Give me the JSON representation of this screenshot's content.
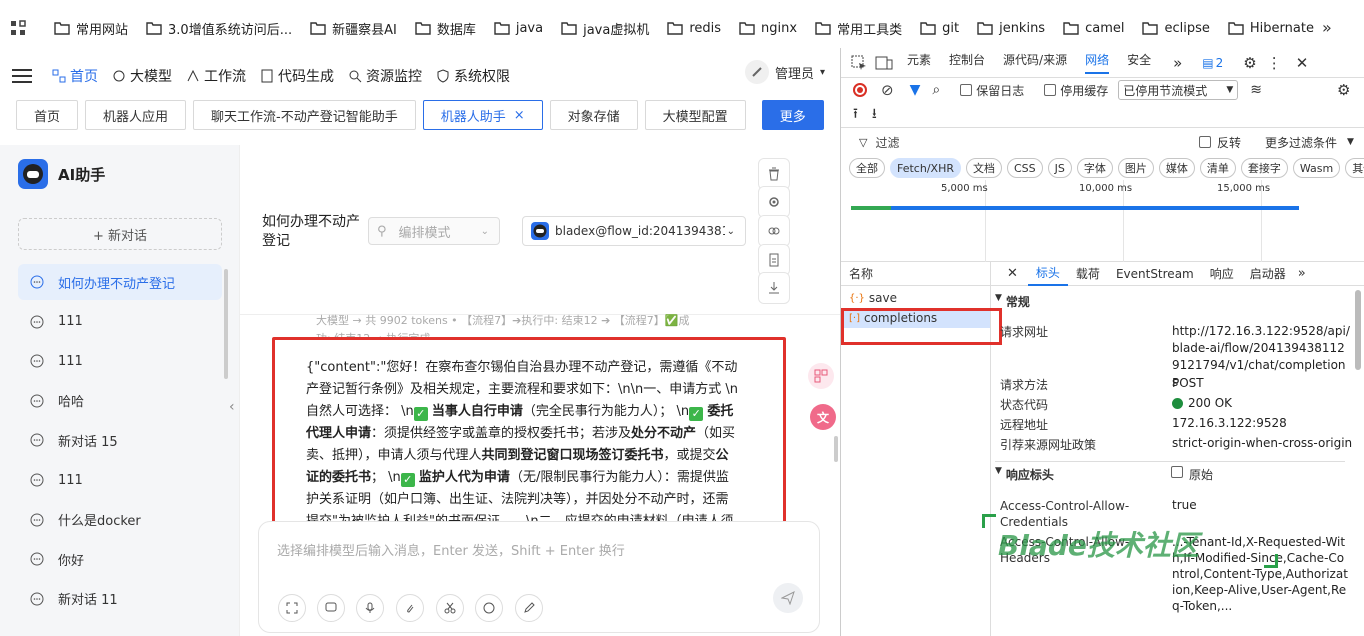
{
  "bookmarks": [
    "常用网站",
    "3.0增值系统访问后...",
    "新疆察县AI",
    "数据库",
    "java",
    "java虚拟机",
    "redis",
    "nginx",
    "常用工具类",
    "git",
    "jenkins",
    "camel",
    "eclipse",
    "Hibernate"
  ],
  "nav": {
    "items": [
      "首页",
      "大模型",
      "工作流",
      "代码生成",
      "资源监控",
      "系统权限"
    ],
    "user": "管理员"
  },
  "tabs": [
    "首页",
    "机器人应用",
    "聊天工作流-不动产登记智能助手",
    "机器人助手",
    "对象存储",
    "大模型配置"
  ],
  "tabs_more": "更多",
  "tab_close": "×",
  "sidebar": {
    "title": "AI助手",
    "new_chat": "+ 新对话",
    "chats": [
      "如何办理不动产登记",
      "111",
      "111",
      "哈哈",
      "新对话 15",
      "111",
      "什么是docker",
      "你好",
      "新对话 11"
    ]
  },
  "chat": {
    "question": "如何办理不动产登记",
    "mode_placeholder": "编排模式",
    "flow_select": "bladex@flow_id:2041394381",
    "faded_line1": "大模型 → 共 9902 tokens • 【流程7】➔执行中: 结束12 ➔ 【流程7】✅成",
    "faded_line2": "功: 结束12 → 执行完成",
    "msg": {
      "p1": "{\"content\":\"您好！在察布查尔锡伯自治县办理不动产登记，需遵循《不动产登记暂行条例》及相关规定，主要流程和要求如下：\\n\\n一、申请方式 \\n自然人可选择： \\n",
      "b1": "当事人自行申请",
      "p2": "（完全民事行为能力人）； \\n",
      "b2": "委托代理人申请",
      "p3": "：须提供经签字或盖章的授权委托书；若涉及",
      "b3": "处分不动产",
      "p4": "（如买卖、抵押），申请人须与代理人",
      "b4": "共同到登记窗口现场签订委托书",
      "p5": "，或提交",
      "b5": "公证的委托书",
      "p6": "； \\n",
      "b6": "监护人代为申请",
      "p7": "（无/限制民事行为能力人）：需提供监护关系证明（如户口簿、出生证、法院判决等），并因处分不动产时，还需提交\"为",
      "p8": "被监护人利益\"的书面保证……\\n二、应提交的申请材料（申请人须如实"
    },
    "input_placeholder": "选择编排模型后输入消息，Enter 发送，Shift + Enter 换行"
  },
  "devtools": {
    "top_tabs": [
      "元素",
      "控制台",
      "源代码/来源",
      "网络",
      "安全"
    ],
    "badge": "2",
    "preserve_log": "保留日志",
    "disable_cache": "停用缓存",
    "throttle": "已停用节流模式",
    "filter": "过滤",
    "invert": "反转",
    "more_filters": "更多过滤条件",
    "chips": [
      "全部",
      "Fetch/XHR",
      "文档",
      "CSS",
      "JS",
      "字体",
      "图片",
      "媒体",
      "清单",
      "套接字",
      "Wasm",
      "其他"
    ],
    "timeline_ticks": [
      "5,000 ms",
      "10,000 ms",
      "15,000 ms"
    ],
    "name_header": "名称",
    "requests": [
      "save",
      "completions"
    ],
    "detail_tabs": [
      "标头",
      "载荷",
      "EventStream",
      "响应",
      "启动器"
    ],
    "general_title": "常规",
    "general": [
      {
        "k": "请求网址",
        "v": "http://172.16.3.122:9528/api/blade-ai/flow/2041394381129121794/v1/chat/completions"
      },
      {
        "k": "请求方法",
        "v": "POST"
      },
      {
        "k": "状态代码",
        "v": "200 OK"
      },
      {
        "k": "远程地址",
        "v": "172.16.3.122:9528"
      },
      {
        "k": "引荐来源网址政策",
        "v": "strict-origin-when-cross-origin"
      }
    ],
    "response_title": "响应标头",
    "raw": "原始",
    "resp": [
      {
        "k": "Access-Control-Allow-Credentials",
        "v": "true"
      },
      {
        "k": "Access-Control-Allow-Headers",
        "v": "...-Tenant-Id,X-Requested-With,If-Modified-Since,Cache-Control,Content-Type,Authorization,Keep-Alive,User-Agent,Req-Token,..."
      }
    ],
    "watermark": "Blade技术社区"
  },
  "colors": {
    "accent": "#2a6ee8",
    "highlight": "#e0312b",
    "ok": "#1e8e3e"
  }
}
